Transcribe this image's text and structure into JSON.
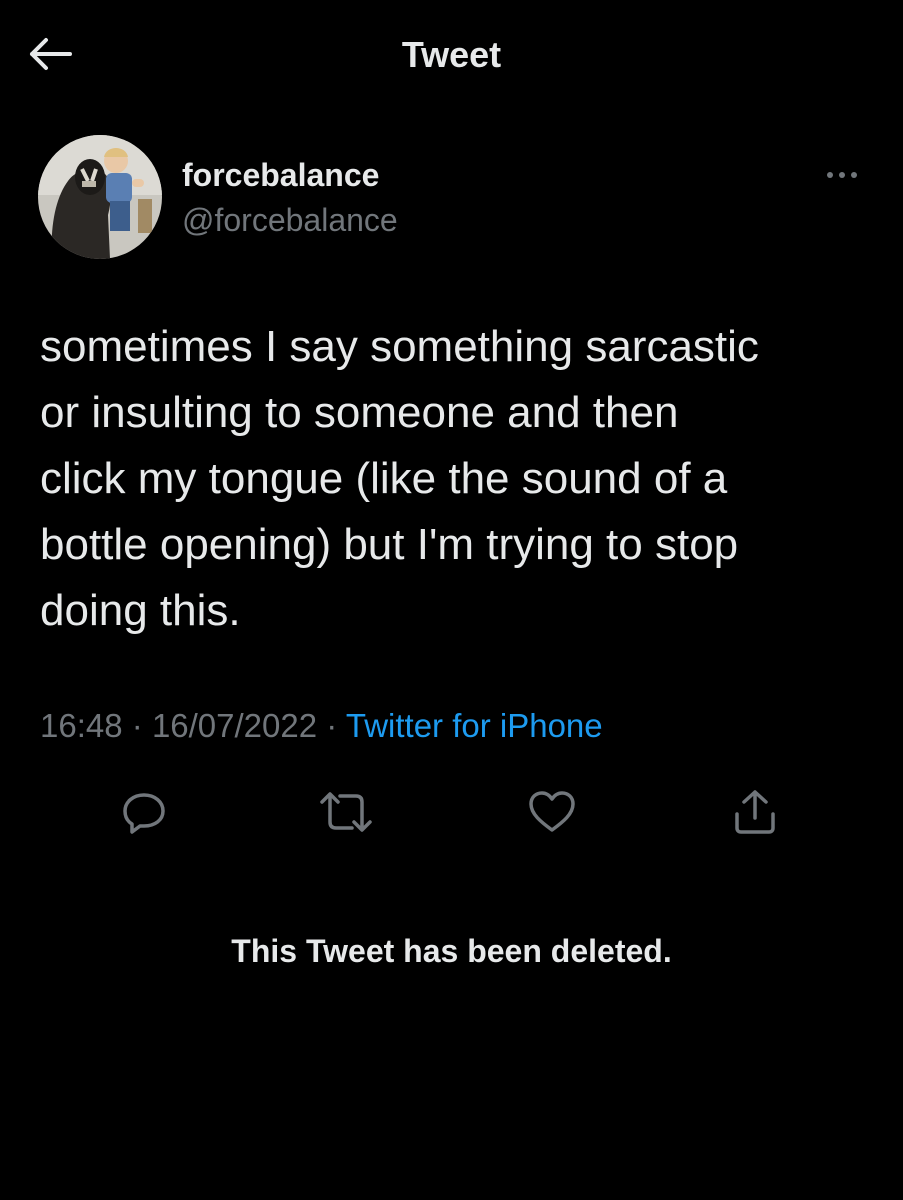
{
  "header": {
    "title": "Tweet",
    "back_icon": "arrow-left-icon"
  },
  "author": {
    "display_name": "forcebalance",
    "handle": "@forcebalance",
    "avatar": "profile-photo",
    "more_icon": "more-horizontal-icon"
  },
  "tweet": {
    "text": "sometimes I say something sarcastic\nor insulting to someone and then\nclick my tongue (like the sound of a\nbottle opening) but I'm trying to stop\ndoing this.",
    "time": "16:48",
    "date": "16/07/2022",
    "separator": "·",
    "source": "Twitter for iPhone"
  },
  "actions": [
    {
      "name": "reply",
      "icon": "reply-icon"
    },
    {
      "name": "retweet",
      "icon": "retweet-icon"
    },
    {
      "name": "like",
      "icon": "heart-icon"
    },
    {
      "name": "share",
      "icon": "share-icon"
    }
  ],
  "notice": {
    "text": "This Tweet has been deleted."
  },
  "colors": {
    "background": "#000000",
    "primary_text": "#e7e9ea",
    "secondary_text": "#71767b",
    "link": "#1d9bf0"
  }
}
